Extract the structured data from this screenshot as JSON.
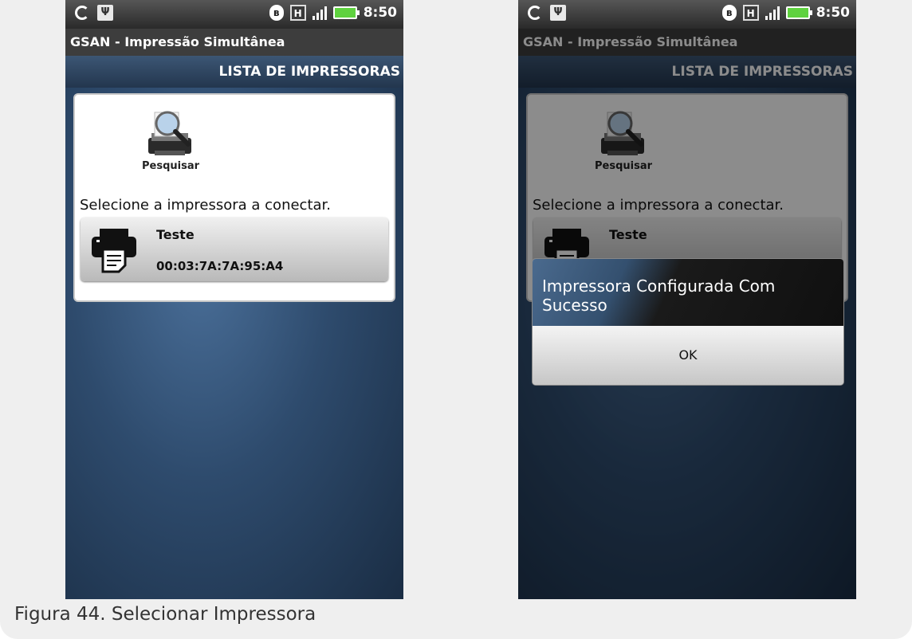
{
  "statusbar": {
    "time": "8:50",
    "usb_glyph": "Ψ",
    "bt_glyph": "ʙ",
    "h_glyph": "H"
  },
  "app": {
    "title": "GSAN - Impressão Simultânea",
    "header": "LISTA DE IMPRESSORAS"
  },
  "search": {
    "label": "Pesquisar"
  },
  "instruction": "Selecione a impressora a conectar.",
  "printers": [
    {
      "name": "Teste",
      "mac": "00:03:7A:7A:95:A4"
    }
  ],
  "dialog": {
    "message": "Impressora Configurada Com Sucesso",
    "ok_label": "OK"
  },
  "caption": "Figura 44. Selecionar Impressora",
  "colors": {
    "header_blue": "#2d4664",
    "battery_green": "#5fd23f"
  },
  "icons": [
    "sync-icon",
    "usb-icon",
    "bluetooth-icon",
    "h-network-icon",
    "signal-icon",
    "battery-icon",
    "search-printer-icon",
    "printer-icon"
  ]
}
